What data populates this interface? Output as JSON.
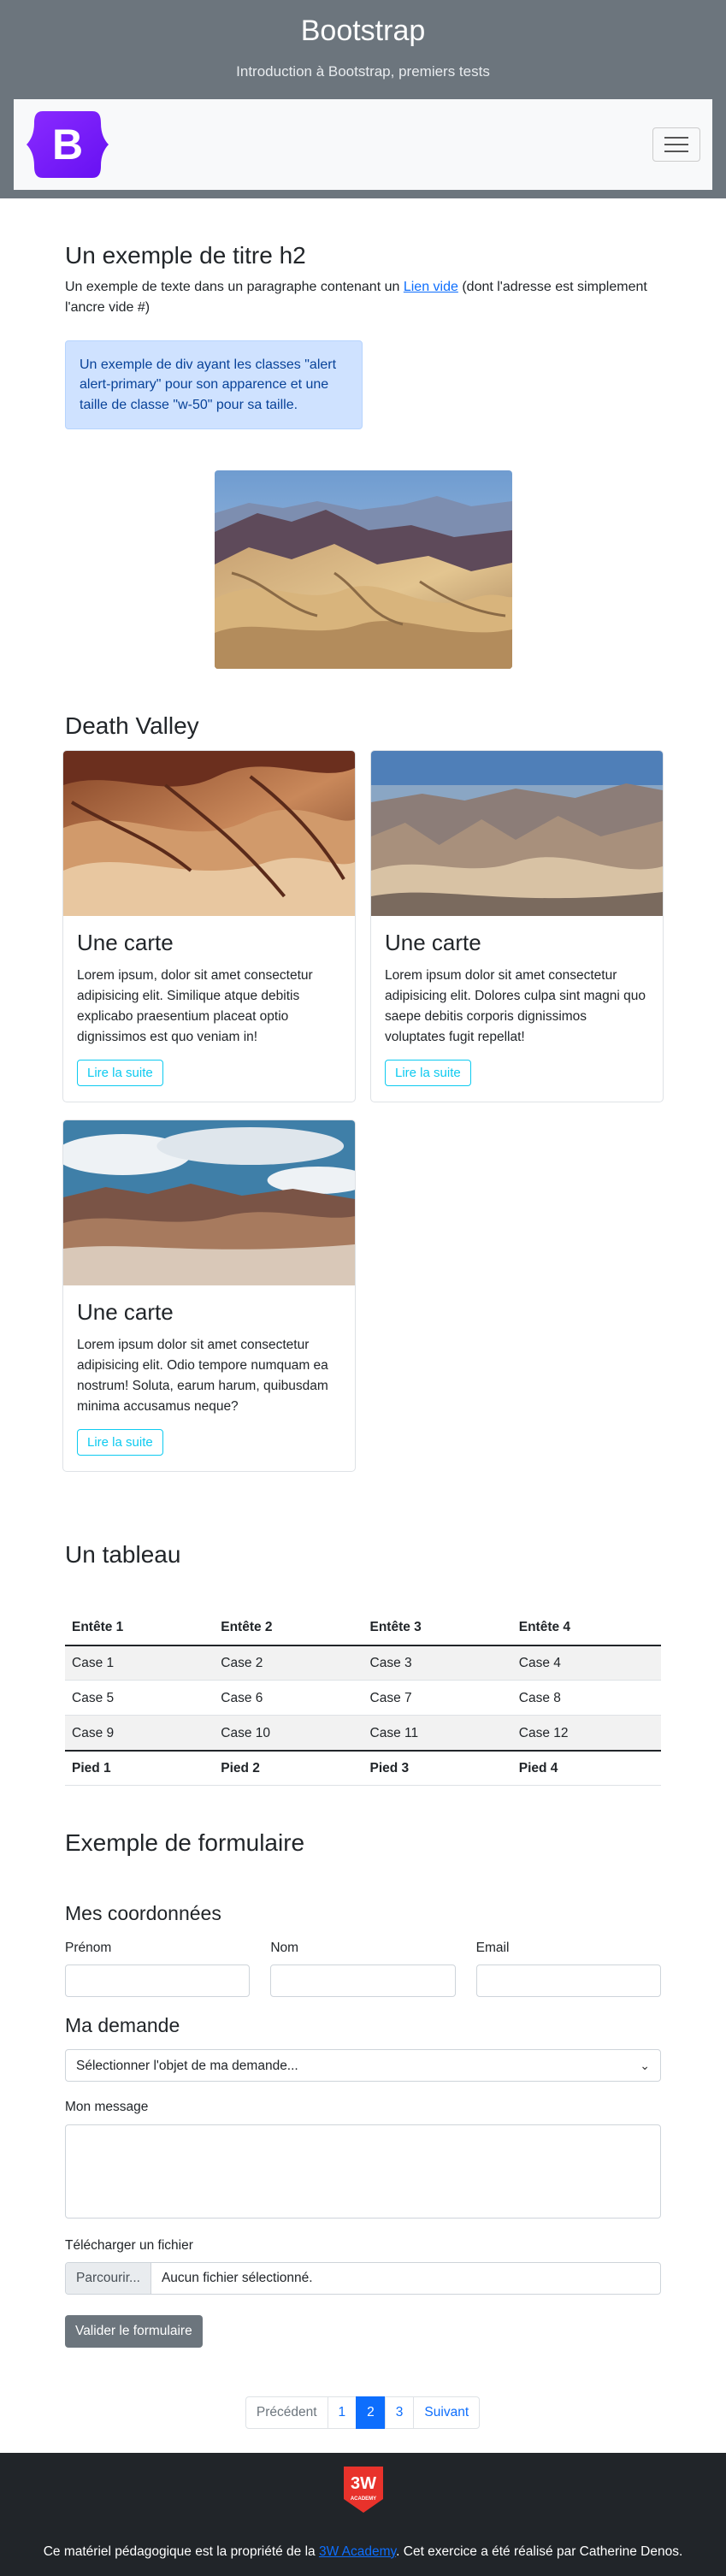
{
  "header": {
    "title": "Bootstrap",
    "subtitle": "Introduction à Bootstrap, premiers tests",
    "logo_letter": "B"
  },
  "intro": {
    "heading": "Un exemple de titre h2",
    "text_before": "Un exemple de texte dans un paragraphe contenant un ",
    "link": "Lien vide",
    "text_after": " (dont l'adresse est simplement l'ancre vide #)",
    "alert": "Un exemple de div ayant les classes \"alert alert-primary\" pour son apparence et une taille de classe \"w-50\" pour sa taille."
  },
  "death_valley": {
    "heading": "Death Valley",
    "cards": [
      {
        "title": "Une carte",
        "text": "Lorem ipsum, dolor sit amet consectetur adipisicing elit. Similique atque debitis explicabo praesentium placeat optio dignissimos est quo veniam in!",
        "button": "Lire la suite"
      },
      {
        "title": "Une carte",
        "text": "Lorem ipsum dolor sit amet consectetur adipisicing elit. Dolores culpa sint magni quo saepe debitis corporis dignissimos voluptates fugit repellat!",
        "button": "Lire la suite"
      },
      {
        "title": "Une carte",
        "text": "Lorem ipsum dolor sit amet consectetur adipisicing elit. Odio tempore numquam ea nostrum! Soluta, earum harum, quibusdam minima accusamus neque?",
        "button": "Lire la suite"
      }
    ]
  },
  "table": {
    "heading": "Un tableau",
    "headers": [
      "Entête 1",
      "Entête 2",
      "Entête 3",
      "Entête 4"
    ],
    "rows": [
      [
        "Case 1",
        "Case 2",
        "Case 3",
        "Case 4"
      ],
      [
        "Case 5",
        "Case 6",
        "Case 7",
        "Case 8"
      ],
      [
        "Case 9",
        "Case 10",
        "Case 11",
        "Case 12"
      ]
    ],
    "footer": [
      "Pied 1",
      "Pied 2",
      "Pied 3",
      "Pied 4"
    ]
  },
  "form": {
    "heading": "Exemple de formulaire",
    "coords_heading": "Mes coordonnées",
    "firstname_label": "Prénom",
    "lastname_label": "Nom",
    "email_label": "Email",
    "demande_heading": "Ma demande",
    "select_value": "Sélectionner l'objet de ma demande...",
    "message_label": "Mon message",
    "file_label": "Télécharger un fichier",
    "file_button": "Parcourir...",
    "file_name": "Aucun fichier sélectionné.",
    "submit": "Valider le formulaire"
  },
  "pagination": {
    "prev": "Précédent",
    "pages": [
      "1",
      "2",
      "3"
    ],
    "active": "2",
    "next": "Suivant"
  },
  "footer": {
    "logo_text": "3W",
    "logo_sub": "ACADEMY",
    "text_before": "Ce matériel pédagogique est la propriété de la ",
    "link": "3W Academy",
    "text_after": ". Cet exercice a été réalisé par Catherine Denos."
  },
  "colors": {
    "brand_purple": "#7a1cf6",
    "primary": "#0d6efd",
    "info": "#0dcaf0",
    "secondary": "#6c757d",
    "dark": "#212529",
    "academy_red": "#e8322b"
  }
}
